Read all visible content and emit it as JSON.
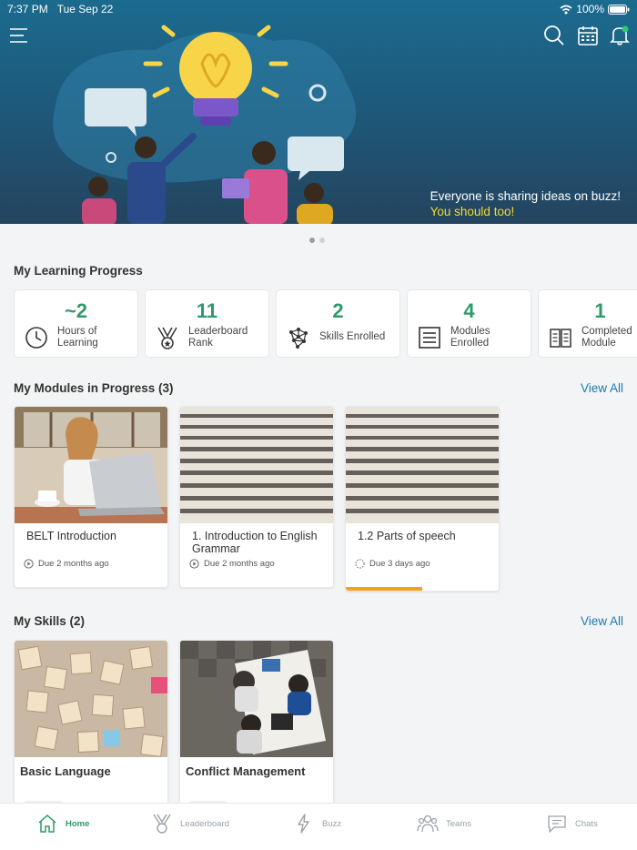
{
  "status_bar": {
    "time": "7:37 PM",
    "date": "Tue Sep 22",
    "battery": "100%"
  },
  "hero": {
    "caption_line1": "Everyone is sharing ideas on buzz!",
    "caption_line2": "You should too!"
  },
  "progress_section": {
    "title": "My Learning Progress",
    "stats": [
      {
        "value": "~2",
        "label": "Hours of Learning",
        "icon": "clock-icon"
      },
      {
        "value": "11",
        "label": "Leaderboard Rank",
        "icon": "medal-icon"
      },
      {
        "value": "2",
        "label": "Skills Enrolled",
        "icon": "network-icon"
      },
      {
        "value": "4",
        "label": "Modules Enrolled",
        "icon": "list-icon"
      },
      {
        "value": "1",
        "label": "Completed Module",
        "icon": "book-icon"
      }
    ]
  },
  "modules_section": {
    "title": "My Modules in Progress (3)",
    "view_all": "View All",
    "modules": [
      {
        "title": "BELT Introduction",
        "due": "Due 2 months ago",
        "image": "woman-laptop-photo",
        "progress": 0
      },
      {
        "title": "1. Introduction to English Grammar",
        "due": "Due 2 months ago",
        "image": "dictionary-photo",
        "progress": 0
      },
      {
        "title": "1.2 Parts of speech",
        "due": "Due 3 days ago",
        "image": "dictionary-photo",
        "progress": 0.5
      }
    ]
  },
  "skills_section": {
    "title": "My Skills (2)",
    "view_all": "View All",
    "skills": [
      {
        "title": "Basic Language",
        "image": "scrabble-tiles-photo"
      },
      {
        "title": "Conflict Management",
        "image": "meeting-overhead-photo"
      }
    ]
  },
  "tab_bar": {
    "tabs": [
      {
        "label": "Home",
        "icon": "home-icon",
        "active": true
      },
      {
        "label": "Leaderboard",
        "icon": "medal-icon",
        "active": false
      },
      {
        "label": "Buzz",
        "icon": "lightning-icon",
        "active": false
      },
      {
        "label": "Teams",
        "icon": "people-icon",
        "active": false
      },
      {
        "label": "Chats",
        "icon": "chat-icon",
        "active": false
      }
    ]
  },
  "colors": {
    "accent_green": "#2e9a6a",
    "link_blue": "#1d7bb0",
    "progress_orange": "#f5a11c",
    "caption_yellow": "#f5dc2c"
  }
}
